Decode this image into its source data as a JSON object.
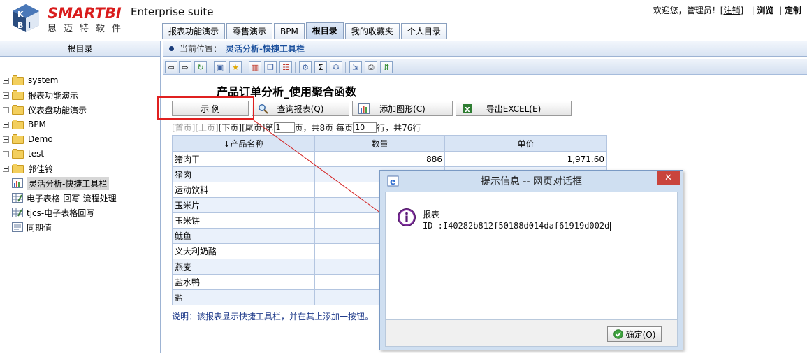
{
  "header": {
    "brand": "SMARTBI",
    "brand_sub": "思迈特软件",
    "product": "Enterprise suite",
    "welcome": "欢迎您，管理员！[",
    "logout": "注销",
    "welcome_end": "]",
    "browse": "浏览",
    "customize": "定制"
  },
  "tabs": [
    {
      "label": "报表功能演示"
    },
    {
      "label": "零售演示"
    },
    {
      "label": "BPM"
    },
    {
      "label": "根目录",
      "active": true
    },
    {
      "label": "我的收藏夹"
    },
    {
      "label": "个人目录"
    }
  ],
  "sidebar": {
    "title": "根目录",
    "items": [
      {
        "label": "system",
        "type": "folder"
      },
      {
        "label": "报表功能演示",
        "type": "folder"
      },
      {
        "label": "仪表盘功能演示",
        "type": "folder"
      },
      {
        "label": "BPM",
        "type": "folder"
      },
      {
        "label": "Demo",
        "type": "folder"
      },
      {
        "label": "test",
        "type": "folder"
      },
      {
        "label": "郭佳铃",
        "type": "folder"
      },
      {
        "label": "灵活分析-快捷工具栏",
        "type": "chart-report",
        "selected": true
      },
      {
        "label": "电子表格-回写-流程处理",
        "type": "spreadsheet"
      },
      {
        "label": "tjcs-电子表格回写",
        "type": "spreadsheet"
      },
      {
        "label": "同期值",
        "type": "report"
      }
    ]
  },
  "location": {
    "label": "当前位置：",
    "value": "灵活分析-快捷工具栏"
  },
  "report": {
    "title": "产品订单分析_使用聚合函数",
    "actions": {
      "example": "示 例",
      "query": "查询报表(Q)",
      "add_chart": "添加图形(C)",
      "export": "导出EXCEL(E)"
    },
    "pager": {
      "first": "[首页]",
      "prev": "[上页]",
      "next": "[下页]",
      "last": "[尾页]",
      "page_prefix": "第",
      "page_value": "1",
      "page_suffix": "页，共8页",
      "per_page_prefix": "每页",
      "per_page_value": "10",
      "per_page_suffix": "行，共76行"
    },
    "columns": [
      "↓产品名称",
      "数量",
      "单价"
    ],
    "rows": [
      {
        "name": "猪肉干",
        "qty": "886",
        "price": "1,971.60"
      },
      {
        "name": "猪肉",
        "qty": "",
        "price": ""
      },
      {
        "name": "运动饮料",
        "qty": "",
        "price": ""
      },
      {
        "name": "玉米片",
        "qty": "",
        "price": ""
      },
      {
        "name": "玉米饼",
        "qty": "",
        "price": ""
      },
      {
        "name": "鱿鱼",
        "qty": "",
        "price": ""
      },
      {
        "name": "义大利奶酪",
        "qty": "",
        "price": ""
      },
      {
        "name": "燕麦",
        "qty": "",
        "price": ""
      },
      {
        "name": "盐水鸭",
        "qty": "",
        "price": ""
      },
      {
        "name": "盐",
        "qty": "",
        "price": ""
      }
    ],
    "note": "说明：该报表显示快捷工具栏，并在其上添加一按钮。"
  },
  "dialog": {
    "title": "提示信息 -- 网页对话框",
    "close": "✕",
    "line1": "报表",
    "line2": "ID :I40282b812f50188d014daf61919d002d",
    "ok": "确定(O)"
  },
  "colors": {
    "brand_red": "#d91c1c",
    "header_blue": "#d9e4f3",
    "highlight": "#e02020",
    "note_blue": "#1e3a8a"
  }
}
